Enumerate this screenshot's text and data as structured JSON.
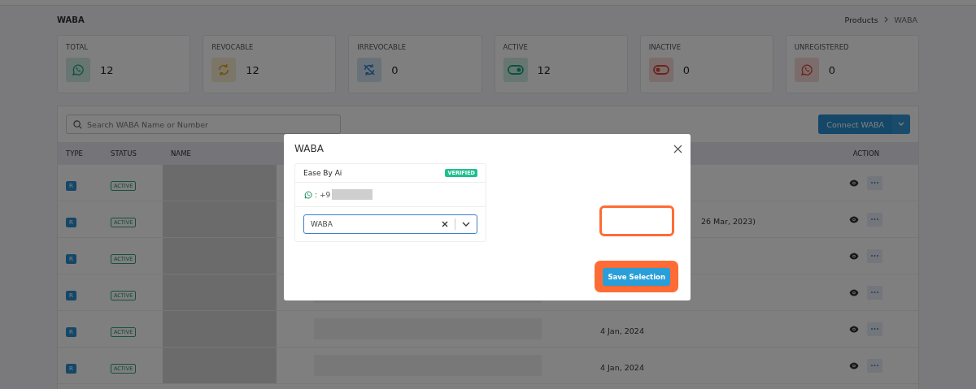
{
  "page": {
    "title": "WABA",
    "breadcrumb": [
      "Products",
      "WABA"
    ]
  },
  "stats": [
    {
      "label": "TOTAL",
      "value": "12",
      "kind": "whatsapp"
    },
    {
      "label": "REVOCABLE",
      "value": "12",
      "kind": "sync"
    },
    {
      "label": "IRREVOCABLE",
      "value": "0",
      "kind": "sync-off"
    },
    {
      "label": "ACTIVE",
      "value": "12",
      "kind": "toggle-on"
    },
    {
      "label": "INACTIVE",
      "value": "0",
      "kind": "toggle-off"
    },
    {
      "label": "UNREGISTERED",
      "value": "0",
      "kind": "whatsapp-off"
    }
  ],
  "search": {
    "placeholder": "Search WABA Name or Number"
  },
  "connect_button": "Connect WABA",
  "table": {
    "columns": [
      "TYPE",
      "STATUS",
      "NAME",
      "ACTION"
    ],
    "rows": [
      {
        "type": "R",
        "status": "ACTIVE"
      },
      {
        "type": "R",
        "status": "ACTIVE",
        "note": "26 Mar, 2023)"
      },
      {
        "type": "R",
        "status": "ACTIVE"
      },
      {
        "type": "R",
        "status": "ACTIVE"
      },
      {
        "type": "R",
        "status": "ACTIVE",
        "date": "4 Jan, 2024"
      },
      {
        "type": "R",
        "status": "ACTIVE",
        "date": "4 Jan, 2024"
      }
    ]
  },
  "modal": {
    "title": "WABA",
    "account": "Ease By Ai",
    "badge": "VERIFIED",
    "phone": ": +9",
    "select_value": "WABA",
    "save_button": "Save Selection"
  }
}
